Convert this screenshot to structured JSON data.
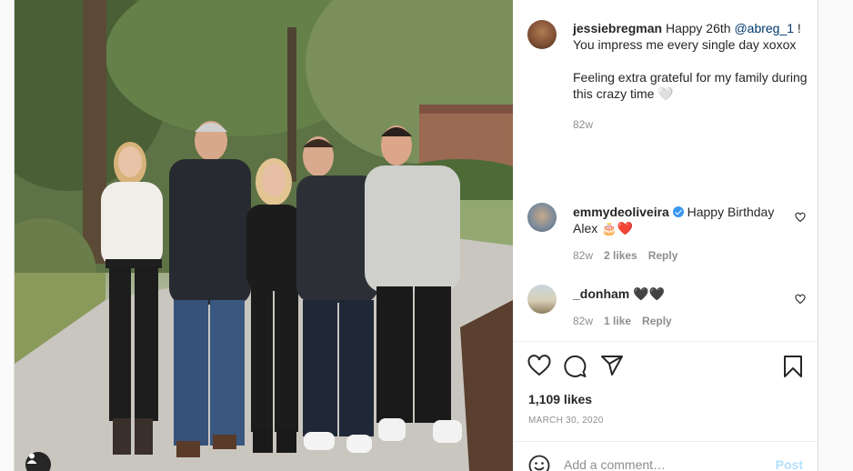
{
  "post": {
    "author": "jessiebregman",
    "caption_pre": "Happy 26th ",
    "caption_mention": "@abreg_1",
    "caption_post": " !",
    "caption_line2": "You impress me every single day xoxox",
    "caption_para2": "Feeling extra grateful for my family during this crazy time 🤍",
    "caption_time": "82w"
  },
  "comments": [
    {
      "username": "emmydeoliveira",
      "verified": true,
      "text": "Happy Birthday Alex 🎂❤️",
      "time": "82w",
      "likes": "2 likes",
      "reply": "Reply"
    },
    {
      "username": "_donham",
      "verified": false,
      "text": "🖤🖤",
      "time": "82w",
      "likes": "1 like",
      "reply": "Reply"
    }
  ],
  "stats": {
    "likes": "1,109 likes",
    "date": "MARCH 30, 2020"
  },
  "composer": {
    "placeholder": "Add a comment…",
    "post_label": "Post"
  },
  "icons": {
    "like": "heart-icon",
    "comment": "comment-bubble-icon",
    "share": "paper-plane-icon",
    "save": "bookmark-icon",
    "emoji": "emoji-face-icon",
    "tag": "user-tag-icon"
  },
  "colors": {
    "mention": "#00376b",
    "verified": "#3897f0",
    "post_button": "#b2dffc",
    "muted": "#8e8e8e"
  }
}
